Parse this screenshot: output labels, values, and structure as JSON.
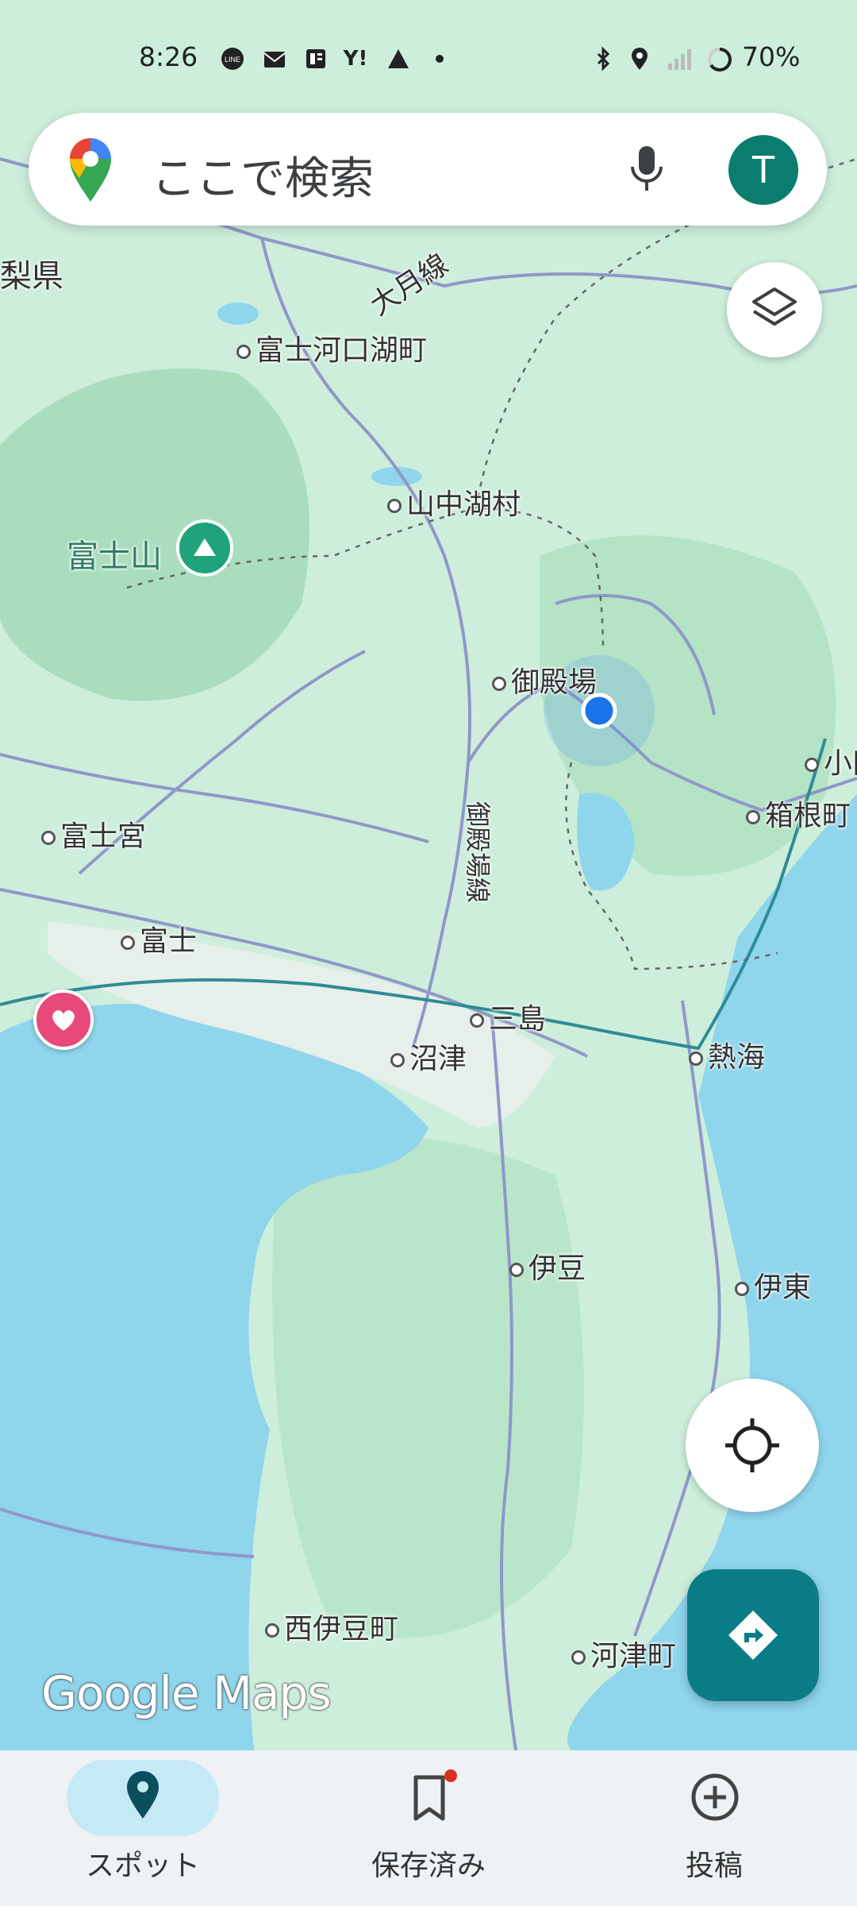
{
  "status_bar": {
    "time": "8:26",
    "left_icons": [
      "line-icon",
      "mail-icon",
      "news-icon",
      "yahoo-icon",
      "triangle-icon",
      "dot-icon"
    ],
    "right_icons": [
      "bluetooth-icon",
      "location-icon",
      "signal-icon",
      "battery-ring-icon"
    ],
    "battery": "70%"
  },
  "search": {
    "placeholder": "ここで検索",
    "avatar_letter": "T"
  },
  "map": {
    "places": [
      {
        "name": "山梨県",
        "kind": "region"
      },
      {
        "name": "大月線",
        "kind": "road"
      },
      {
        "name": "富士河口湖町",
        "kind": "town"
      },
      {
        "name": "山中湖村",
        "kind": "town"
      },
      {
        "name": "富士山",
        "kind": "landmark"
      },
      {
        "name": "御殿場",
        "kind": "town"
      },
      {
        "name": "御殿場線",
        "kind": "rail"
      },
      {
        "name": "小田原",
        "kind": "town"
      },
      {
        "name": "箱根町",
        "kind": "town"
      },
      {
        "name": "富士宮",
        "kind": "town"
      },
      {
        "name": "富士",
        "kind": "town"
      },
      {
        "name": "三島",
        "kind": "town"
      },
      {
        "name": "沼津",
        "kind": "town"
      },
      {
        "name": "熱海",
        "kind": "town"
      },
      {
        "name": "伊豆",
        "kind": "town"
      },
      {
        "name": "伊東",
        "kind": "town"
      },
      {
        "name": "西伊豆町",
        "kind": "town"
      },
      {
        "name": "河津町",
        "kind": "town"
      }
    ],
    "visible_labels": {
      "region": "梨県",
      "road": "大月線",
      "kawaguchiko": "富士河口湖町",
      "yamanakako": "山中湖村",
      "fuji_san": "富士山",
      "gotemba": "御殿場",
      "gotemba_line": "御殿場線",
      "odawara": "小田",
      "hakone": "箱根町",
      "fujinomiya": "富士宮",
      "fuji": "富士",
      "mishima": "三島",
      "numazu": "沼津",
      "atami": "熱海",
      "izu": "伊豆",
      "ito": "伊東",
      "nishiizu": "西伊豆町",
      "kawazu": "河津町"
    },
    "colors": {
      "land": "#cdeedb",
      "forest": "#a9ddbd",
      "water": "#8fd5ec",
      "road": "#8f98c8",
      "rail": "#2f8b96"
    }
  },
  "controls": {
    "layers_icon": "layers-icon",
    "my_location_icon": "crosshair-icon",
    "directions_icon": "directions-icon"
  },
  "branding": {
    "logo": "Google Maps"
  },
  "bottom_nav": {
    "items": [
      {
        "label": "スポット",
        "icon": "pin-icon",
        "active": true
      },
      {
        "label": "保存済み",
        "icon": "bookmark-icon",
        "active": false,
        "badge": true
      },
      {
        "label": "投稿",
        "icon": "plus-circle-icon",
        "active": false
      }
    ]
  }
}
